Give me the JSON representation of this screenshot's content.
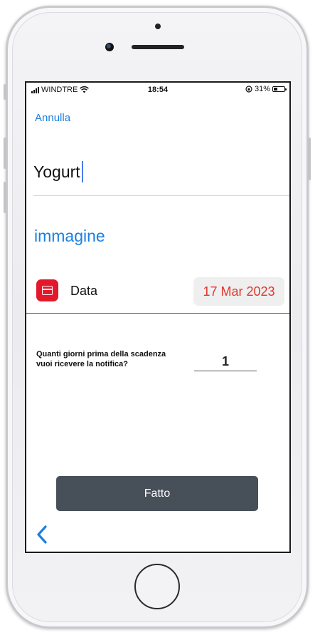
{
  "status_bar": {
    "carrier": "WINDTRE",
    "time": "18:54",
    "battery": "31%"
  },
  "nav": {
    "cancel_label": "Annulla"
  },
  "item": {
    "name_value": "Yogurt",
    "image_label": "immagine"
  },
  "date_row": {
    "label": "Data",
    "value": "17 Mar 2023",
    "icon": "calendar-icon"
  },
  "notification": {
    "question_line1": "Quanti giorni prima della scadenza",
    "question_line2": "vuoi ricevere la notifica?",
    "days_value": "1"
  },
  "actions": {
    "done_label": "Fatto",
    "back_icon": "chevron-left-icon"
  },
  "colors": {
    "link": "#1a7fe0",
    "date_text": "#e2362f",
    "calendar_icon_bg": "#e3192b",
    "done_button_bg": "#474f59"
  }
}
